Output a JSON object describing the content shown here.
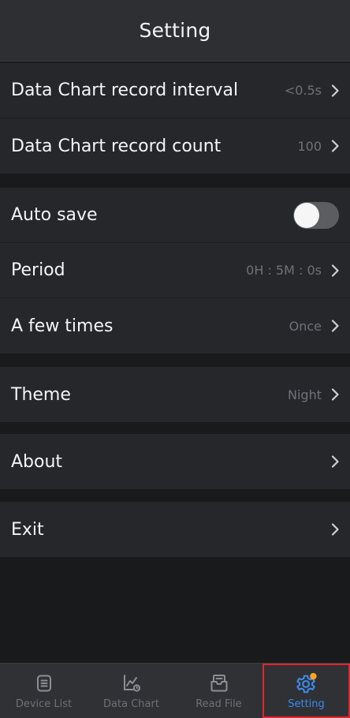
{
  "header": {
    "title": "Setting"
  },
  "groups": [
    {
      "rows": [
        {
          "label": "Data Chart record interval",
          "value": "<0.5s"
        },
        {
          "label": "Data Chart record count",
          "value": "100"
        }
      ]
    },
    {
      "rows": [
        {
          "label": "Auto save",
          "toggle": false
        },
        {
          "label": "Period",
          "value": "0H : 5M : 0s"
        },
        {
          "label": "A few times",
          "value": "Once"
        }
      ]
    },
    {
      "rows": [
        {
          "label": "Theme",
          "value": "Night"
        }
      ]
    },
    {
      "rows": [
        {
          "label": "About"
        }
      ]
    },
    {
      "rows": [
        {
          "label": "Exit"
        }
      ]
    }
  ],
  "tabbar": {
    "items": [
      {
        "label": "Device List",
        "icon": "device-list-icon"
      },
      {
        "label": "Data Chart",
        "icon": "data-chart-icon"
      },
      {
        "label": "Read File",
        "icon": "read-file-icon"
      },
      {
        "label": "Setting",
        "icon": "gear-icon",
        "active": true,
        "badge": true
      }
    ]
  },
  "colors": {
    "background": "#191a1c",
    "row": "#25272a",
    "header": "#2d2f33",
    "tab_active": "#3d8bf0",
    "badge": "#f5a623",
    "highlight_box": "#e0262b"
  }
}
